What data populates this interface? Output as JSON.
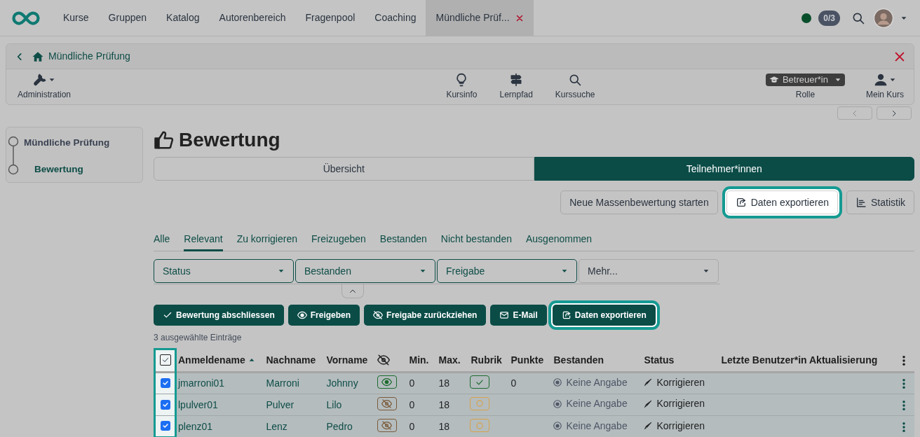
{
  "nav": {
    "items": [
      {
        "label": "Kurse",
        "selected": false
      },
      {
        "label": "Gruppen",
        "selected": false
      },
      {
        "label": "Katalog",
        "selected": false
      },
      {
        "label": "Autorenbereich",
        "selected": false
      },
      {
        "label": "Fragenpool",
        "selected": false
      },
      {
        "label": "Coaching",
        "selected": false
      },
      {
        "label": "Mündliche Prüf...",
        "selected": true,
        "closable": true
      }
    ],
    "online": true,
    "counter": "0/3"
  },
  "course": {
    "title": "Mündliche Prüfung",
    "tools_left": [
      {
        "label": "Administration",
        "kind": "wrench"
      }
    ],
    "tools_center": [
      {
        "label": "Kursinfo",
        "kind": "bulb"
      },
      {
        "label": "Lernpfad",
        "kind": "signpost"
      },
      {
        "label": "Kurssuche",
        "kind": "search"
      }
    ],
    "role": {
      "value": "Betreuer*in",
      "label": "Rolle"
    },
    "my_course": "Mein Kurs"
  },
  "sidebar": {
    "items": [
      {
        "label": "Mündliche Prüfung",
        "selected": false
      },
      {
        "label": "Bewertung",
        "selected": true
      }
    ]
  },
  "title": "Bewertung",
  "segments": [
    {
      "label": "Übersicht",
      "selected": false
    },
    {
      "label": "Teilnehmer*innen",
      "selected": true
    }
  ],
  "actions": [
    {
      "label": "Neue Massenbewertung starten",
      "kind": "plain",
      "highlighted": false
    },
    {
      "label": "Daten exportieren",
      "kind": "export",
      "highlighted": true
    },
    {
      "label": "Statistik",
      "kind": "chart",
      "highlighted": false
    }
  ],
  "filter_tabs": [
    {
      "label": "Alle",
      "selected": false
    },
    {
      "label": "Relevant",
      "selected": true
    },
    {
      "label": "Zu korrigieren",
      "selected": false
    },
    {
      "label": "Freizugeben",
      "selected": false
    },
    {
      "label": "Bestanden",
      "selected": false
    },
    {
      "label": "Nicht bestanden",
      "selected": false
    },
    {
      "label": "Ausgenommen",
      "selected": false
    }
  ],
  "filters": [
    {
      "label": "Status",
      "active": true
    },
    {
      "label": "Bestanden",
      "active": true
    },
    {
      "label": "Freigabe",
      "active": true
    },
    {
      "label": "Mehr...",
      "active": false
    }
  ],
  "bulk_actions": [
    {
      "label": "Bewertung abschliessen",
      "kind": "check",
      "highlighted": false
    },
    {
      "label": "Freigeben",
      "kind": "eye",
      "highlighted": false
    },
    {
      "label": "Freigabe zurückziehen",
      "kind": "eye-off",
      "highlighted": false
    },
    {
      "label": "E-Mail",
      "kind": "mail",
      "highlighted": false
    },
    {
      "label": "Daten exportieren",
      "kind": "export",
      "highlighted": true
    }
  ],
  "selection_info": "3 ausgewählte Einträge",
  "table": {
    "select_all": true,
    "select_column_highlighted": true,
    "columns": [
      "Anmeldename",
      "Nachname",
      "Vorname",
      "Min.",
      "Max.",
      "Rubrik",
      "Punkte",
      "Bestanden",
      "Status",
      "Letzte Benutzer*in Aktualisierung"
    ],
    "rows": [
      {
        "checked": true,
        "login": "jmarroni01",
        "last": "Marroni",
        "first": "Johnny",
        "visible": true,
        "min": "0",
        "max": "18",
        "rubric_done": true,
        "points": "0",
        "passed": "Keine Angabe",
        "status": "Korrigieren"
      },
      {
        "checked": true,
        "login": "lpulver01",
        "last": "Pulver",
        "first": "Lilo",
        "visible": false,
        "min": "0",
        "max": "18",
        "rubric_done": false,
        "passed": "Keine Angabe",
        "status": "Korrigieren"
      },
      {
        "checked": true,
        "login": "plenz01",
        "last": "Lenz",
        "first": "Pedro",
        "visible": false,
        "min": "0",
        "max": "18",
        "rubric_done": false,
        "passed": "Keine Angabe",
        "status": "Korrigieren"
      }
    ]
  }
}
